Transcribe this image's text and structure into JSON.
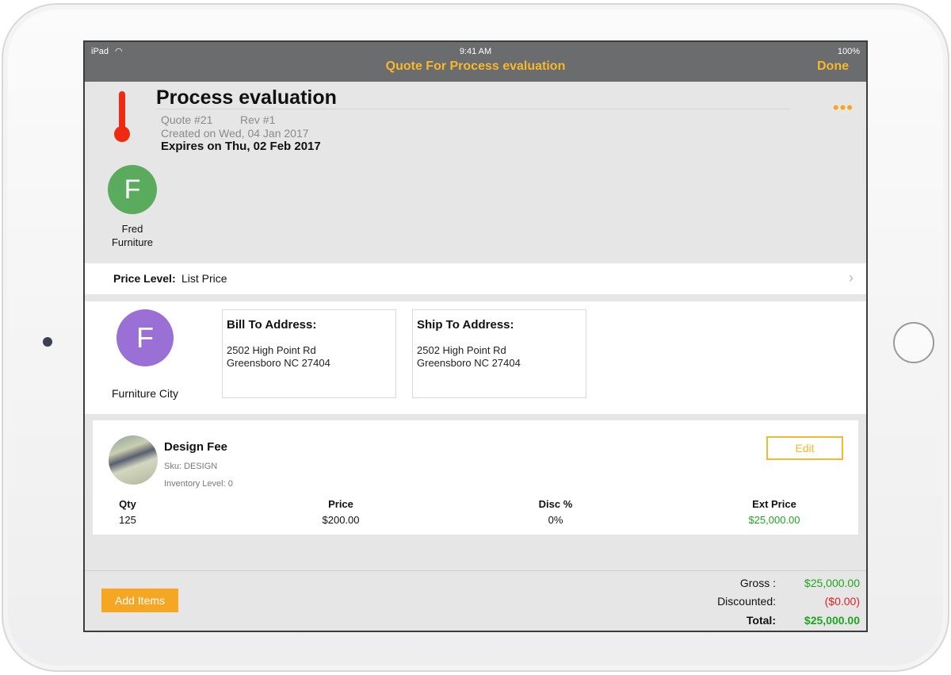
{
  "status": {
    "device": "iPad",
    "time": "9:41 AM",
    "battery": "100%"
  },
  "nav": {
    "title": "Quote For Process evaluation",
    "done": "Done"
  },
  "quote": {
    "name": "Process evaluation",
    "number": "Quote #21",
    "rev": "Rev #1",
    "created": "Created on Wed, 04 Jan 2017",
    "expires": "Expires on Thu, 02 Feb 2017"
  },
  "contact": {
    "initial": "F",
    "name_line1": "Fred",
    "name_line2": "Furniture",
    "color": "#5aab5e"
  },
  "price_level": {
    "label": "Price Level:",
    "value": "List Price"
  },
  "customer": {
    "initial": "F",
    "name": "Furniture City",
    "color": "#9a6fd6"
  },
  "bill_to": {
    "title": "Bill To Address:",
    "line1": "2502 High Point Rd",
    "line2": "Greensboro NC 27404"
  },
  "ship_to": {
    "title": "Ship To Address:",
    "line1": "2502 High Point Rd",
    "line2": "Greensboro NC 27404"
  },
  "item": {
    "name": "Design Fee",
    "sku": "Sku: DESIGN",
    "inventory": "Inventory Level: 0",
    "edit": "Edit",
    "headers": {
      "qty": "Qty",
      "price": "Price",
      "disc": "Disc %",
      "ext": "Ext Price"
    },
    "qty": "125",
    "price": "$200.00",
    "disc": "0%",
    "ext": "$25,000.00"
  },
  "footer": {
    "add_items": "Add Items",
    "gross_label": "Gross :",
    "gross": "$25,000.00",
    "discounted_label": "Discounted:",
    "discounted": "($0.00)",
    "total_label": "Total:",
    "total": "$25,000.00"
  },
  "colors": {
    "accent": "#f5b82e",
    "green": "#1ea51e",
    "red": "#e02020"
  }
}
